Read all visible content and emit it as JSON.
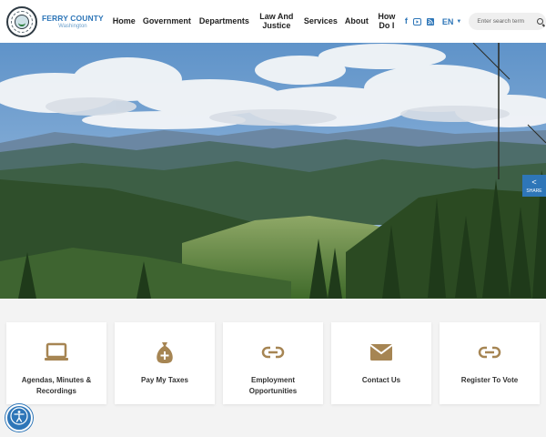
{
  "brand": {
    "name": "FERRY COUNTY",
    "sub": "Washington"
  },
  "nav": [
    {
      "label": "Home"
    },
    {
      "label": "Government"
    },
    {
      "label": "Departments"
    },
    {
      "label": "Law And Justice"
    },
    {
      "label": "Services"
    },
    {
      "label": "About"
    },
    {
      "label": "How Do I"
    }
  ],
  "social": [
    "facebook-icon",
    "youtube-icon",
    "rss-icon"
  ],
  "language": {
    "selected": "EN"
  },
  "search": {
    "placeholder": "Enter search term"
  },
  "share": {
    "label": "SHARE"
  },
  "quick_links": [
    {
      "label": "Agendas, Minutes & Recordings",
      "icon": "laptop-icon"
    },
    {
      "label": "Pay My Taxes",
      "icon": "money-bag-icon"
    },
    {
      "label": "Employment Opportunities",
      "icon": "link-icon"
    },
    {
      "label": "Contact Us",
      "icon": "envelope-icon"
    },
    {
      "label": "Register To Vote",
      "icon": "link-icon"
    }
  ],
  "colors": {
    "accent": "#2e76b8",
    "icon_tan": "#a68553"
  }
}
